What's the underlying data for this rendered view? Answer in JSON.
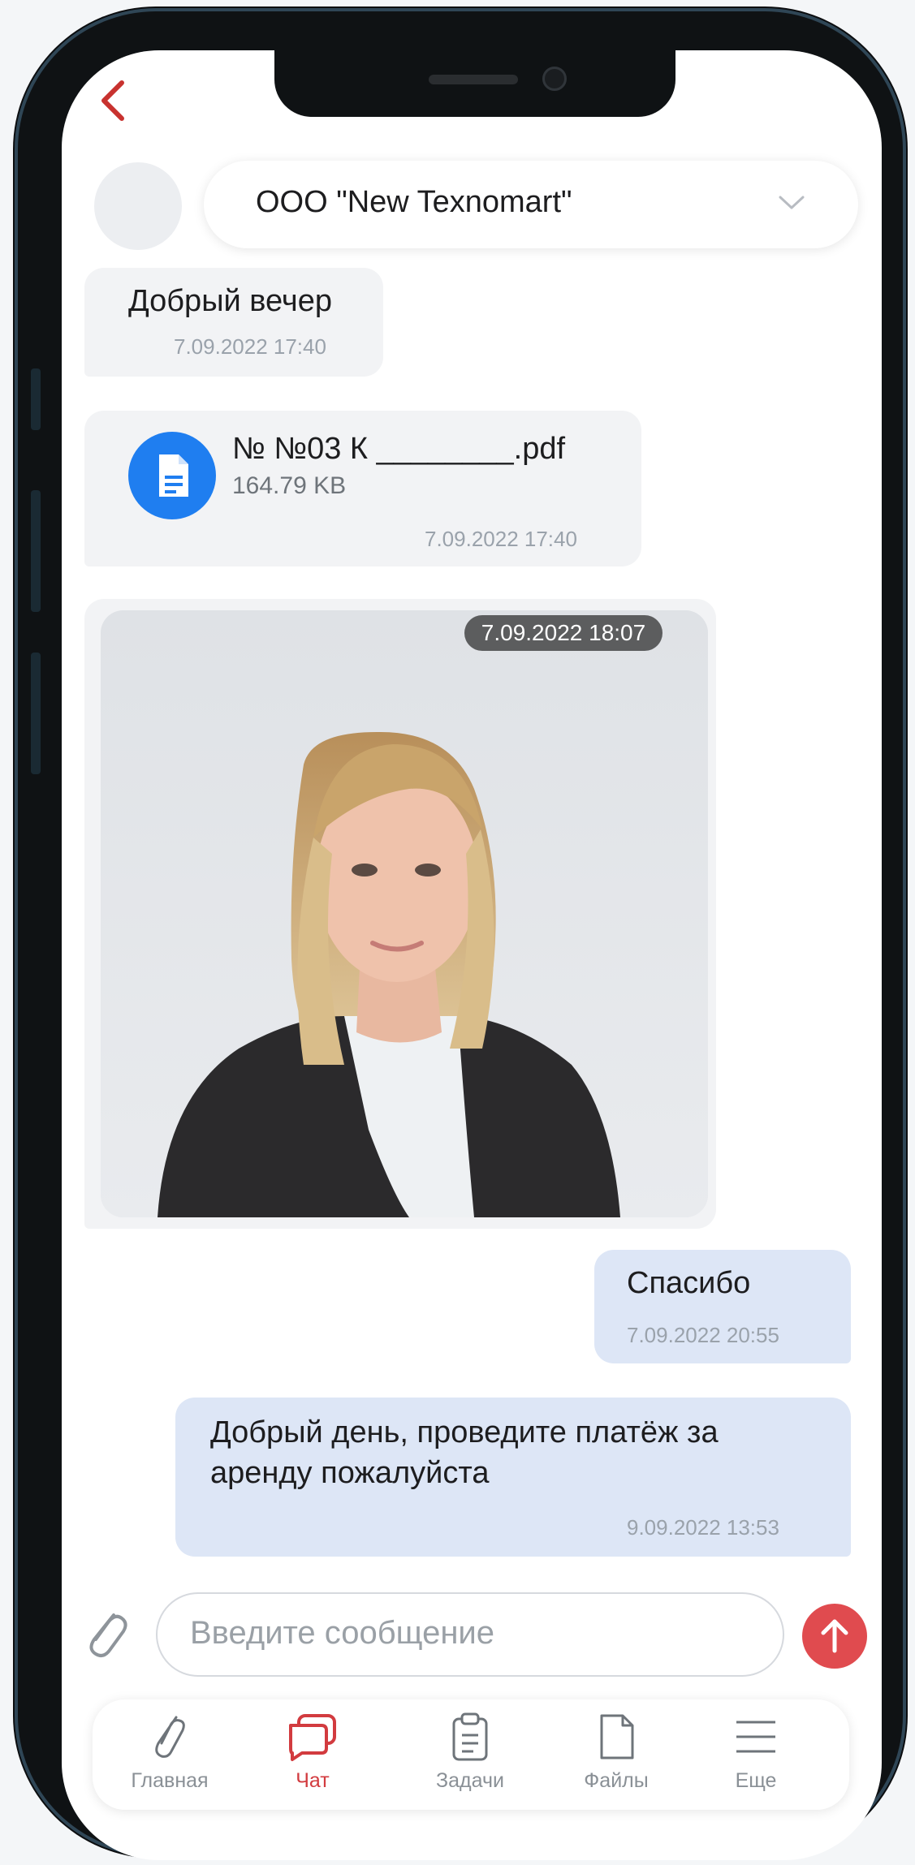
{
  "header": {
    "chat_name": "ООО \"New Texnomart\""
  },
  "messages": [
    {
      "kind": "text",
      "direction": "in",
      "text": "Добрый вечер",
      "time": "7.09.2022 17:40"
    },
    {
      "kind": "file",
      "direction": "in",
      "file_name": "№ №03 К ________.pdf",
      "file_size": "164.79 KB",
      "time": "7.09.2022 17:40"
    },
    {
      "kind": "image",
      "direction": "in",
      "time": "7.09.2022 18:07"
    },
    {
      "kind": "text",
      "direction": "out",
      "text": "Спасибо",
      "time": "7.09.2022 20:55"
    },
    {
      "kind": "text",
      "direction": "out",
      "text_line1": "Добрый день, проведите платёж за",
      "text_line2": "аренду пожалуйста",
      "time": "9.09.2022 13:53"
    }
  ],
  "composer": {
    "placeholder": "Введите сообщение"
  },
  "tabbar": {
    "items": [
      {
        "label": "Главная",
        "icon": "paperclip-icon",
        "active": false
      },
      {
        "label": "Чат",
        "icon": "chat-icon",
        "active": true
      },
      {
        "label": "Задачи",
        "icon": "clipboard-icon",
        "active": false
      },
      {
        "label": "Файлы",
        "icon": "file-icon",
        "active": false
      },
      {
        "label": "Еще",
        "icon": "menu-icon",
        "active": false
      }
    ]
  },
  "colors": {
    "accent": "#d23b3f",
    "outgoing_bubble": "#dde6f6",
    "incoming_bubble": "#f2f3f5",
    "file_icon": "#1f7ef0",
    "send_button": "#e04b4f"
  }
}
